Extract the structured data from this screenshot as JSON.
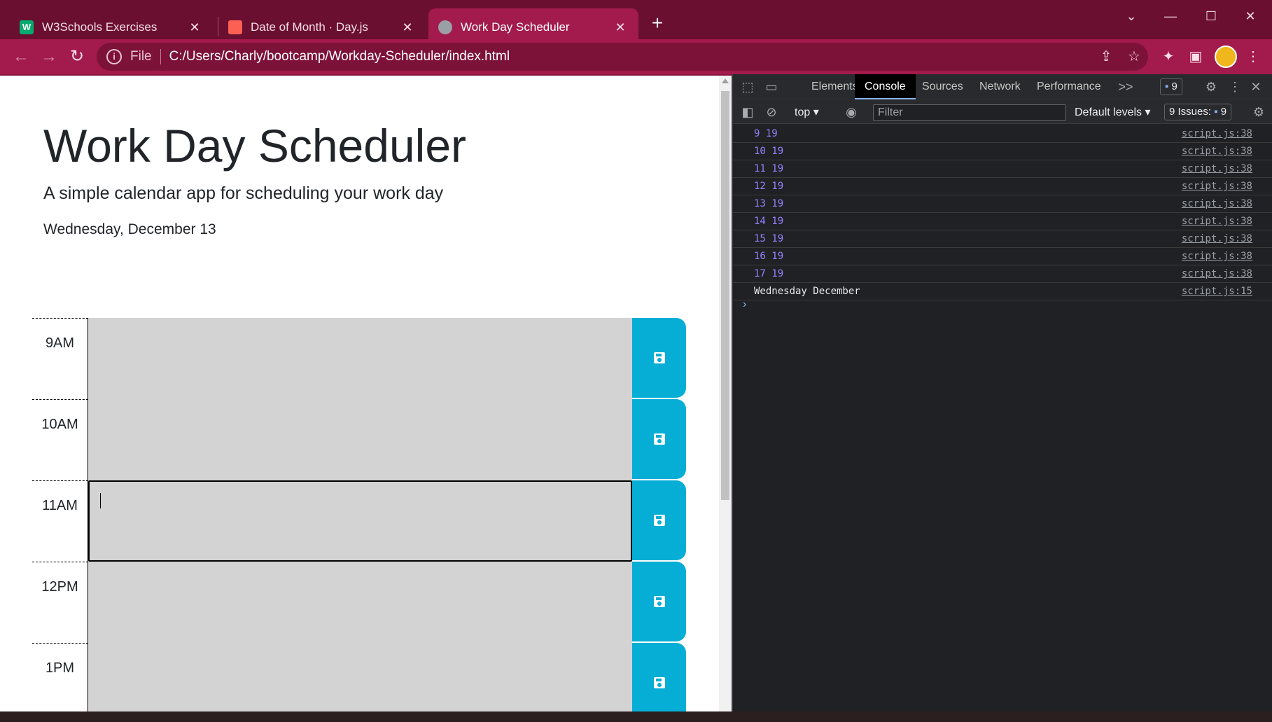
{
  "browser": {
    "tabs": [
      {
        "label": "W3Schools Exercises",
        "favicon_color": "#04aa6d",
        "active": false
      },
      {
        "label": "Date of Month · Day.js",
        "favicon_color": "#fb6052",
        "active": false
      },
      {
        "label": "Work Day Scheduler",
        "favicon_color": "#9aa0a6",
        "active": true
      }
    ],
    "new_tab_label": "+",
    "window_controls": {
      "dropdown": "⌄",
      "minimize": "—",
      "maximize": "☐",
      "close": "✕"
    },
    "address": {
      "scheme": "File",
      "url": "C:/Users/Charly/bootcamp/Workday-Scheduler/index.html"
    },
    "theme_colors": {
      "tabstrip": "#6a0f30",
      "toolbar": "#a31a4c"
    }
  },
  "page": {
    "title": "Work Day Scheduler",
    "lead": "A simple calendar app for scheduling your work day",
    "current_day": "Wednesday, December 13",
    "hours": [
      {
        "label": "9AM",
        "text": "",
        "focused": false
      },
      {
        "label": "10AM",
        "text": "",
        "focused": false
      },
      {
        "label": "11AM",
        "text": "",
        "focused": true
      },
      {
        "label": "12PM",
        "text": "",
        "focused": false
      },
      {
        "label": "1PM",
        "text": "",
        "focused": false
      }
    ],
    "colors": {
      "row_fill": "#d3d3d3",
      "save_button": "#06aed5"
    }
  },
  "devtools": {
    "tabs": [
      "Elements",
      "Console",
      "Sources",
      "Network",
      "Performance"
    ],
    "active_tab": "Console",
    "more_tabs": ">>",
    "issues_badge": "9",
    "context": "top",
    "filter_placeholder": "Filter",
    "levels": "Default levels",
    "issues_label": "9 Issues:",
    "issues_count": "9",
    "console_rows": [
      {
        "msg": "9 19",
        "src": "script.js:38",
        "type": "num"
      },
      {
        "msg": "10 19",
        "src": "script.js:38",
        "type": "num"
      },
      {
        "msg": "11 19",
        "src": "script.js:38",
        "type": "num"
      },
      {
        "msg": "12 19",
        "src": "script.js:38",
        "type": "num"
      },
      {
        "msg": "13 19",
        "src": "script.js:38",
        "type": "num"
      },
      {
        "msg": "14 19",
        "src": "script.js:38",
        "type": "num"
      },
      {
        "msg": "15 19",
        "src": "script.js:38",
        "type": "num"
      },
      {
        "msg": "16 19",
        "src": "script.js:38",
        "type": "num"
      },
      {
        "msg": "17 19",
        "src": "script.js:38",
        "type": "num"
      },
      {
        "msg": "Wednesday December",
        "src": "script.js:15",
        "type": "str"
      }
    ],
    "prompt": "›"
  }
}
